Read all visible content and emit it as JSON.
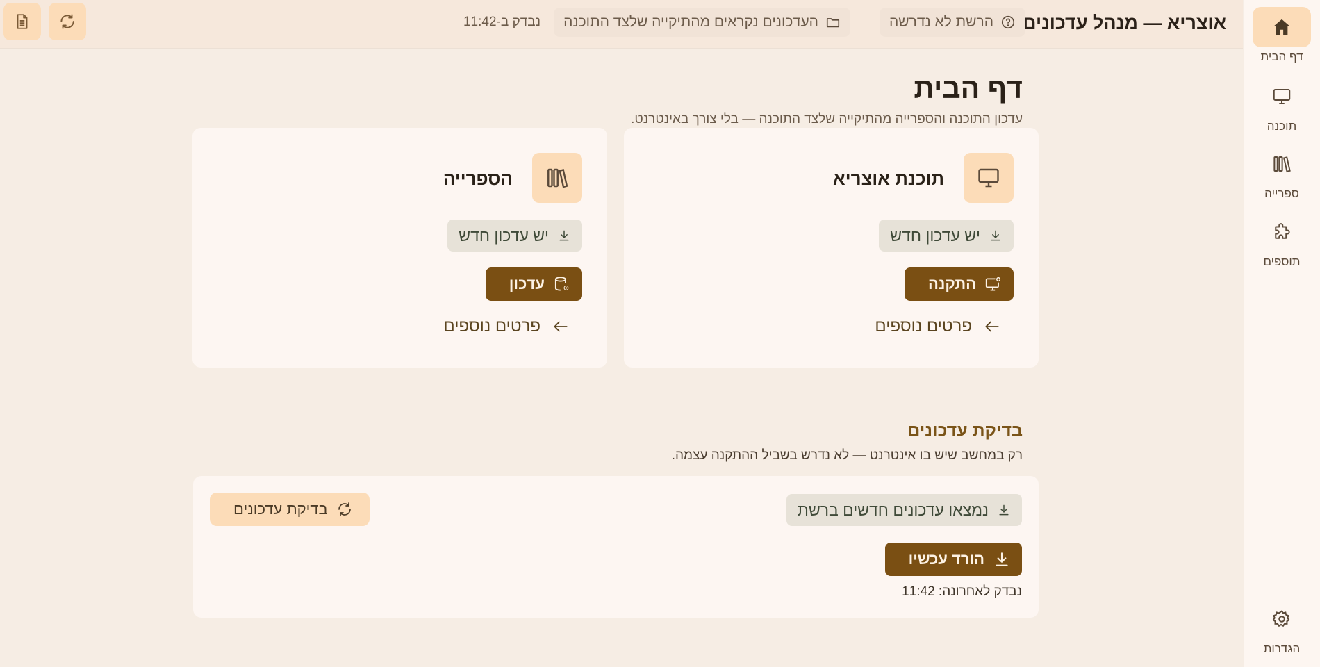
{
  "app": {
    "title": "אוצריא — מנהל עדכונים"
  },
  "header": {
    "network_status": "הרשת לא נדרשה",
    "updates_source": "העדכונים נקראים מהתיקייה שלצד התוכנה",
    "checked_at": "נבדק ב-11:42"
  },
  "sidebar": {
    "items": [
      {
        "label": "דף הבית",
        "icon": "home-icon",
        "active": true
      },
      {
        "label": "תוכנה",
        "icon": "monitor-icon",
        "active": false
      },
      {
        "label": "ספרייה",
        "icon": "books-icon",
        "active": false
      },
      {
        "label": "תוספים",
        "icon": "puzzle-icon",
        "active": false
      }
    ],
    "settings_label": "הגדרות"
  },
  "page": {
    "title": "דף הבית",
    "subtitle": "עדכון התוכנה והספרייה מהתיקייה שלצד התוכנה — בלי צורך באינטרנט."
  },
  "cards": {
    "software": {
      "title": "תוכנת אוצריא",
      "status": "יש עדכון חדש",
      "action": "התקנה",
      "more": "פרטים נוספים"
    },
    "library": {
      "title": "הספרייה",
      "status": "יש עדכון חדש",
      "action": "עדכון",
      "more": "פרטים נוספים"
    }
  },
  "updates": {
    "title": "בדיקת עדכונים",
    "subtitle": "רק במחשב שיש בו אינטרנט — לא נדרש בשביל ההתקנה עצמה.",
    "status": "נמצאו עדכונים חדשים ברשת",
    "download": "הורד עכשיו",
    "check_button": "בדיקת עדכונים",
    "last_checked": "נבדק לאחרונה: 11:42"
  },
  "colors": {
    "accent": "#7a4f13",
    "accent_soft": "#fcdcb8",
    "background": "#f6ede4",
    "card": "#fdf6f2",
    "badge": "#e7e2d8"
  }
}
